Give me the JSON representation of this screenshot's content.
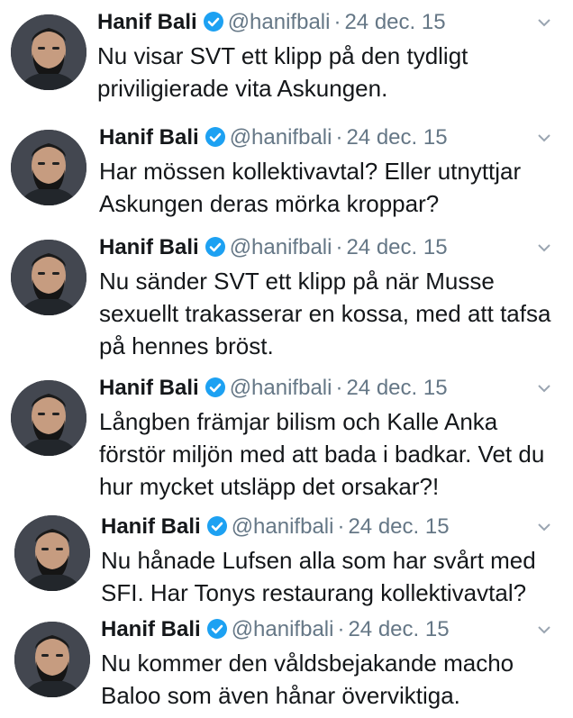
{
  "colors": {
    "name": "#14171a",
    "meta": "#657786",
    "verified": "#1da1f2"
  },
  "icons": {
    "verified": "verified-badge-icon",
    "caret": "chevron-down-icon"
  },
  "tweets": [
    {
      "name": "Hanif Bali",
      "handle": "@hanifbali",
      "separator": "·",
      "date": "24 dec. 15",
      "text": "Nu visar SVT ett klipp på den tydligt priviligierade vita Askungen."
    },
    {
      "name": "Hanif Bali",
      "handle": "@hanifbali",
      "separator": "·",
      "date": "24 dec. 15",
      "text": "Har mössen kollektivavtal? Eller utnyttjar Askungen deras mörka kroppar?"
    },
    {
      "name": "Hanif Bali",
      "handle": "@hanifbali",
      "separator": "·",
      "date": "24 dec. 15",
      "text": "Nu sänder SVT ett klipp på när Musse sexuellt trakasserar en kossa, med att tafsa på hennes bröst."
    },
    {
      "name": "Hanif Bali",
      "handle": "@hanifbali",
      "separator": "·",
      "date": "24 dec. 15",
      "text": "Långben främjar bilism och Kalle Anka förstör miljön med att bada i badkar. Vet du hur mycket utsläpp det orsakar?!"
    },
    {
      "name": "Hanif Bali",
      "handle": "@hanifbali",
      "separator": "·",
      "date": "24 dec. 15",
      "text": "Nu hånade Lufsen alla som har svårt med SFI. Har Tonys restaurang kollektivavtal?"
    },
    {
      "name": "Hanif Bali",
      "handle": "@hanifbali",
      "separator": "·",
      "date": "24 dec. 15",
      "text": "Nu kommer den våldsbejakande macho Baloo som även hånar överviktiga."
    }
  ]
}
